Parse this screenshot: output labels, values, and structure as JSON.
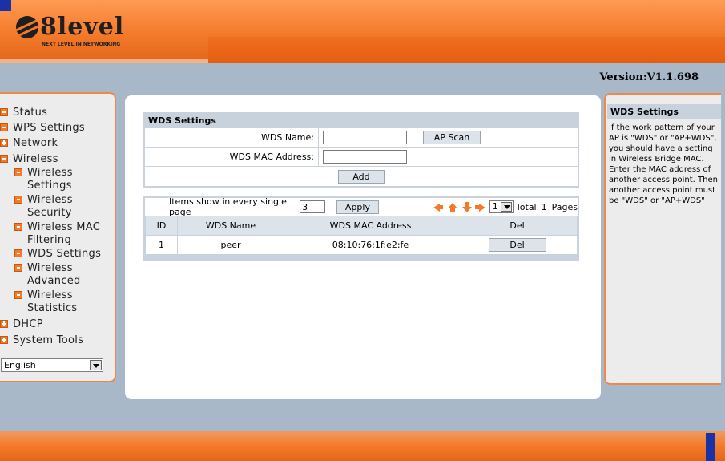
{
  "brand": {
    "logo_text": "8level",
    "tagline": "NEXT LEVEL IN NETWORKING",
    "accent_color": "#f47a2a",
    "corner_color": "#1a32a8"
  },
  "version": "Version:V1.1.698",
  "sidebar": {
    "items": [
      {
        "label": "Status",
        "icon": "square-icon"
      },
      {
        "label": "WPS Settings",
        "icon": "square-icon"
      },
      {
        "label": "Network",
        "icon": "expand-plus-icon"
      },
      {
        "label": "Wireless",
        "icon": "collapse-minus-icon"
      },
      {
        "label": "Wireless Settings",
        "icon": "square-icon"
      },
      {
        "label": "Wireless Security",
        "icon": "square-icon"
      },
      {
        "label": "Wireless MAC Filtering",
        "icon": "square-icon"
      },
      {
        "label": "WDS Settings",
        "icon": "arrow-right-icon"
      },
      {
        "label": "Wireless Advanced",
        "icon": "square-icon"
      },
      {
        "label": "Wireless Statistics",
        "icon": "square-icon"
      },
      {
        "label": "DHCP",
        "icon": "expand-plus-icon"
      },
      {
        "label": "System Tools",
        "icon": "expand-plus-icon"
      }
    ],
    "language": "English"
  },
  "wds": {
    "title": "WDS Settings",
    "name_label": "WDS Name:",
    "name_value": "",
    "scan_button": "AP Scan",
    "mac_label": "WDS MAC Address:",
    "mac_value": "",
    "add_button": "Add"
  },
  "list": {
    "items_label": "Items show in every single page",
    "items_value": "3",
    "apply_button": "Apply",
    "page_value": "1",
    "total_label": "Total",
    "total_value": "1",
    "pages_label": "Pages",
    "columns": [
      "ID",
      "WDS Name",
      "WDS MAC Address",
      "Del"
    ],
    "rows": [
      {
        "id": "1",
        "name": "peer",
        "mac": "08:10:76:1f:e2:fe",
        "del": "Del"
      }
    ]
  },
  "help": {
    "title": "WDS Settings",
    "body": "If the work pattern of your AP is \"WDS\" or \"AP+WDS\", you should have a setting in Wireless Bridge MAC. Enter the MAC address of another access point. Then another access point must be \"WDS\" or \"AP+WDS\""
  }
}
